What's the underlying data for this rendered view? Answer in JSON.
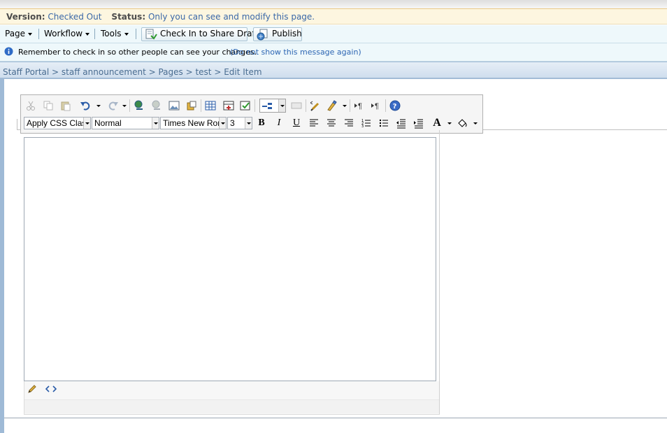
{
  "status_bar": {
    "version_label": "Version:",
    "version_value": "Checked Out",
    "status_label": "Status:",
    "status_value": "Only you can see and modify this page."
  },
  "console": {
    "menus": [
      {
        "label": "Page"
      },
      {
        "label": "Workflow"
      },
      {
        "label": "Tools"
      }
    ],
    "checkin_label": "Check In to Share Draft",
    "publish_label": "Publish"
  },
  "message": {
    "text": "Remember to check in so other people can see your changes.",
    "link": "(Do not show this message again)"
  },
  "breadcrumb": {
    "text": "Staff Portal > staff announcement > Pages > test > Edit Item"
  },
  "editor_toolbar": {
    "css_class": "Apply CSS Class",
    "style": "Normal",
    "font": "Times New Roman",
    "size": "3",
    "bold": "B",
    "italic": "I",
    "underline": "U",
    "font_color_glyph": "A"
  },
  "colors": {
    "accent": "#3a68a8",
    "link": "#2d66b3",
    "breadcrumb": "#4a6d91"
  }
}
